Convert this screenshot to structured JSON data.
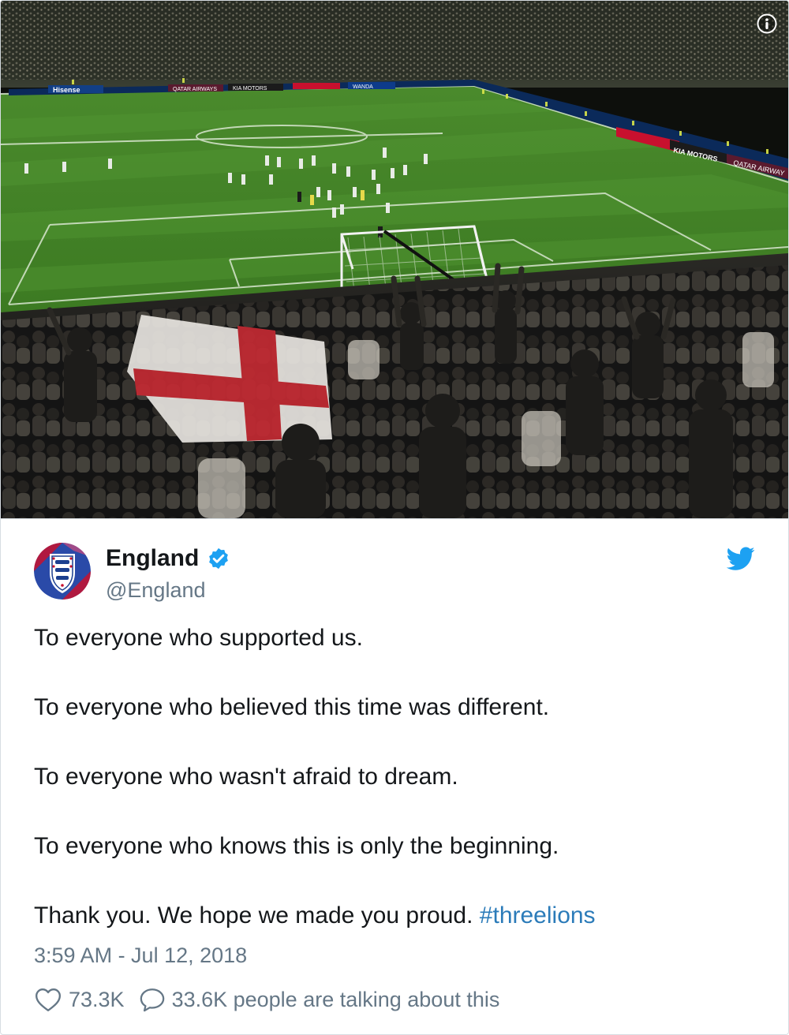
{
  "photo": {
    "description_icon": "info-circle-icon",
    "ad_boards": [
      "Hisense",
      "QATAR AIRWAYS",
      "KIA MOTORS",
      "WANDA",
      "KIA MOTORS",
      "QATAR AIRWAY"
    ]
  },
  "author": {
    "display_name": "England",
    "handle": "@England",
    "verified": true,
    "avatar_icon": "three-lions-crest-icon"
  },
  "platform_icon": "twitter-bird-icon",
  "tweet": {
    "lines": [
      "To everyone who supported us.",
      "To everyone who believed this time was different.",
      "To everyone who wasn't afraid to dream.",
      "To everyone who knows this is only the beginning."
    ],
    "closing_text": "Thank you. We hope we made you proud. ",
    "hashtag": "#threelions",
    "timestamp": "3:59 AM - Jul 12, 2018"
  },
  "actions": {
    "likes": "73.3K",
    "replies": "33.6K people are talking about this"
  },
  "colors": {
    "link": "#2b7bb9",
    "twitter_blue": "#1da1f2",
    "muted": "#657786",
    "text": "#14171a",
    "border": "#d7dde2"
  }
}
